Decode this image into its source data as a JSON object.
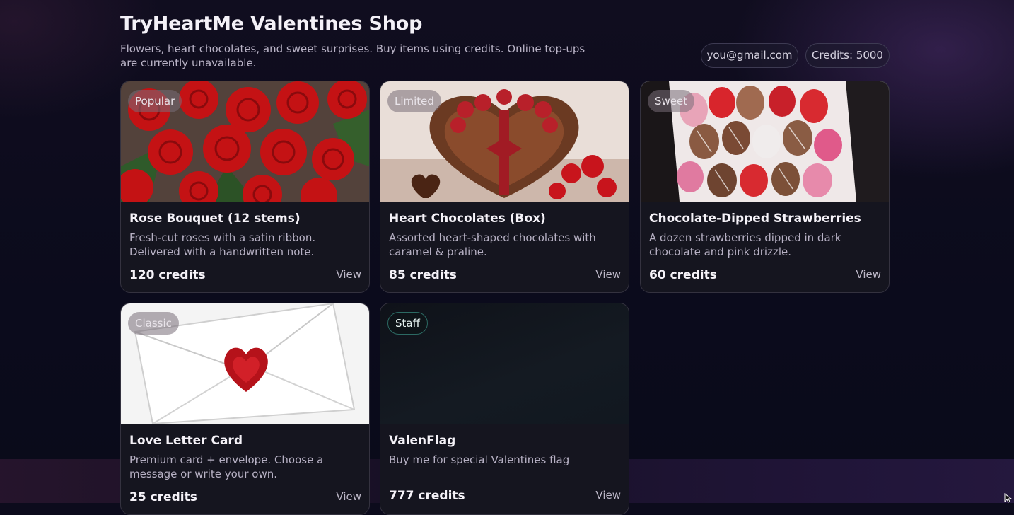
{
  "header": {
    "title": "TryHeartMe Valentines Shop",
    "subtitle": "Flowers, heart chocolates, and sweet surprises. Buy items using credits. Online top-ups are currently unavailable.",
    "email": "you@gmail.com",
    "credits": "Credits: 5000"
  },
  "products": [
    {
      "badge": "Popular",
      "name": "Rose Bouquet (12 stems)",
      "desc": "Fresh-cut roses with a satin ribbon. Delivered with a handwritten note.",
      "price": "120 credits",
      "action": "View"
    },
    {
      "badge": "Limited",
      "name": "Heart Chocolates (Box)",
      "desc": "Assorted heart-shaped chocolates with caramel & praline.",
      "price": "85 credits",
      "action": "View"
    },
    {
      "badge": "Sweet",
      "name": "Chocolate-Dipped Strawberries",
      "desc": "A dozen strawberries dipped in dark chocolate and pink drizzle.",
      "price": "60 credits",
      "action": "View"
    },
    {
      "badge": "Classic",
      "name": "Love Letter Card",
      "desc": "Premium card + envelope. Choose a message or write your own.",
      "price": "25 credits",
      "action": "View"
    },
    {
      "badge": "Staff",
      "name": "ValenFlag",
      "desc": "Buy me for special Valentines flag",
      "price": "777 credits",
      "action": "View"
    }
  ]
}
